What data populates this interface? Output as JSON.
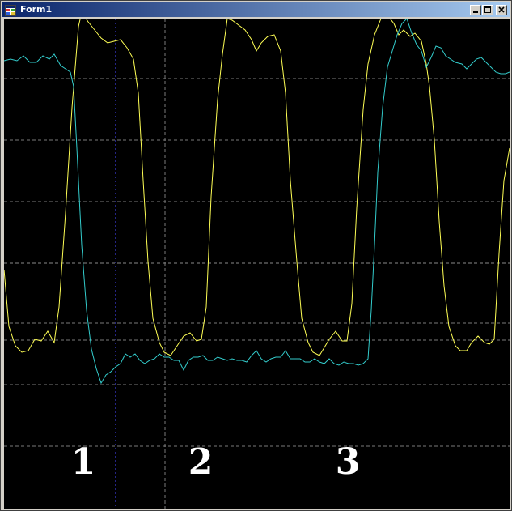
{
  "window": {
    "title": "Form1",
    "icon": "form-app-icon",
    "caption_buttons": [
      "minimize-icon",
      "maximize-icon",
      "close-icon"
    ]
  },
  "plot": {
    "background": "#000000",
    "grid_color": "#7a7a7a",
    "marker_color": "#3b3bd8",
    "yellow_color": "#ffff55",
    "cyan_color": "#33cccc",
    "label_color": "#ffffff",
    "labels": [
      "1",
      "2",
      "3"
    ]
  }
}
